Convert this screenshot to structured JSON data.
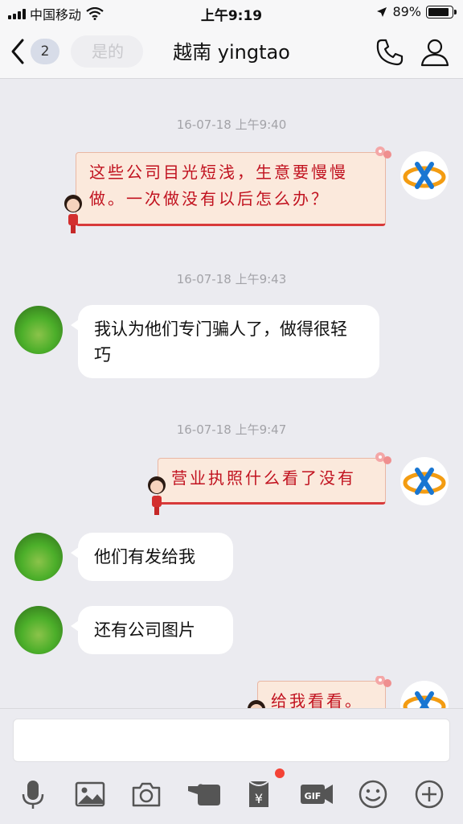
{
  "status_bar": {
    "carrier": "中国移动",
    "time": "上午9:19",
    "battery": "89%",
    "battery_level": 0.89
  },
  "nav": {
    "back_count": "2",
    "prev_preview": "是的",
    "title": "越南 yingtao"
  },
  "messages": [
    {
      "timestamp": "16-07-18 上午9:40",
      "side": "right",
      "style": "card",
      "text": "这些公司目光短浅，生意要慢慢做。一次做没有以后怎么办？"
    },
    {
      "timestamp": "16-07-18 上午9:43",
      "side": "left",
      "style": "bubble",
      "text": "我认为他们专门骗人了，做得很轻巧"
    },
    {
      "timestamp": "16-07-18 上午9:47",
      "side": "right",
      "style": "card",
      "text": "营业执照什么看了没有"
    },
    {
      "side": "left",
      "style": "bubble",
      "text": "他们有发给我"
    },
    {
      "side": "left",
      "style": "bubble",
      "text": "还有公司图片"
    },
    {
      "side": "right",
      "style": "card",
      "text": "给我看看。"
    }
  ],
  "toolbar": {
    "items": [
      "microphone-icon",
      "image-icon",
      "camera-icon",
      "poke-icon",
      "red-packet-icon",
      "gif-icon",
      "emoji-icon",
      "plus-icon"
    ],
    "gif_label": "GIF",
    "red_packet_symbol": "¥"
  },
  "colors": {
    "card_text": "#c1121f",
    "card_bg": "#fbe9dc",
    "accent_red": "#f44336",
    "logo_blue": "#1976d2",
    "logo_orange": "#f39c12"
  }
}
